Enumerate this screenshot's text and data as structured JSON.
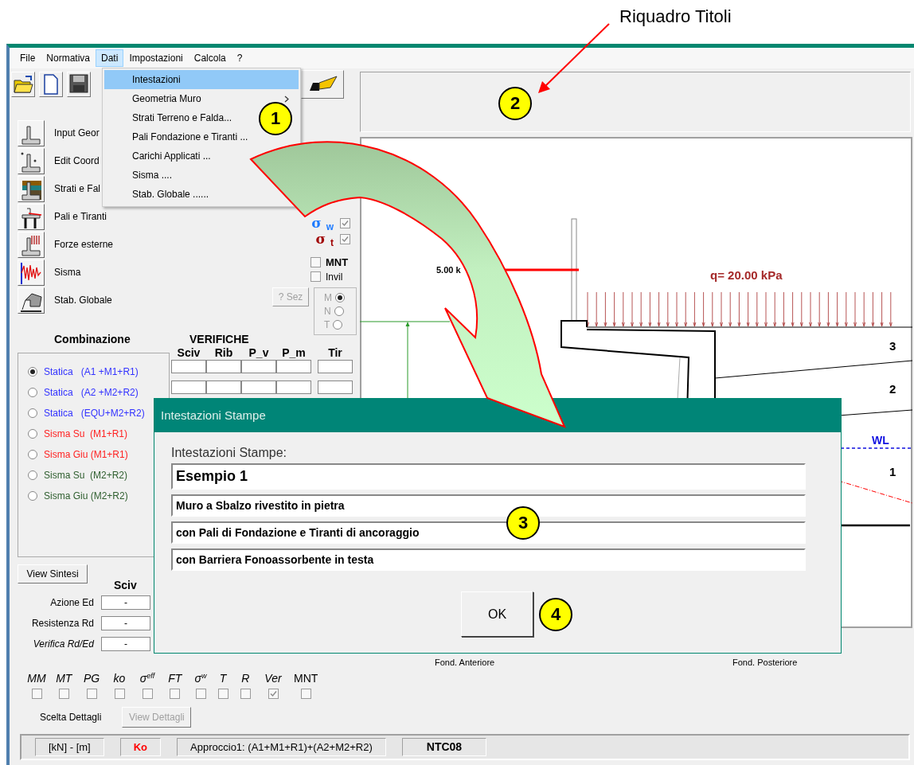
{
  "annotation_label": "Riquadro Titoli",
  "callouts": [
    "1",
    "2",
    "3",
    "4"
  ],
  "menu": [
    {
      "label": "File",
      "selected": false
    },
    {
      "label": "Normativa",
      "selected": false
    },
    {
      "label": "Dati",
      "selected": true
    },
    {
      "label": "Impostazioni",
      "selected": false
    },
    {
      "label": "Calcola",
      "selected": false
    },
    {
      "label": "?",
      "selected": false
    }
  ],
  "dropdown": [
    {
      "label": "Intestazioni",
      "selected": true,
      "submenu": false
    },
    {
      "label": "Geometria Muro",
      "selected": false,
      "submenu": true
    },
    {
      "label": "Strati Terreno e Falda...",
      "selected": false,
      "submenu": false
    },
    {
      "label": "Pali Fondazione e Tiranti ...",
      "selected": false,
      "submenu": false
    },
    {
      "label": "Carichi Applicati ...",
      "selected": false,
      "submenu": false
    },
    {
      "label": "Sisma ....",
      "selected": false,
      "submenu": false
    },
    {
      "label": "Stab. Globale ......",
      "selected": false,
      "submenu": false
    }
  ],
  "tools": [
    "Input Geor",
    "Edit Coord",
    "Strati e Fal",
    "Pali e Tiranti",
    "Forze esterne",
    "Sisma",
    "Stab. Globale"
  ],
  "display_options": [
    {
      "symbol": "σ",
      "sub": "w",
      "checked": true,
      "color": "#1e7bff"
    },
    {
      "symbol": "σ",
      "sub": "t",
      "checked": true,
      "color": "#a00000"
    }
  ],
  "flags": [
    {
      "label": "MNT",
      "checked": false,
      "bold": true
    },
    {
      "label": "Invil",
      "checked": false,
      "bold": false
    }
  ],
  "sez_button": {
    "label": "? Sez",
    "disabled": true
  },
  "section_options": [
    {
      "label": "M",
      "selected": true
    },
    {
      "label": "N",
      "selected": false
    },
    {
      "label": "T",
      "selected": false
    }
  ],
  "combination_title": "Combinazione",
  "combinations": [
    {
      "label": "Statica   (A1 +M1+R1)",
      "selected": true,
      "color": "#3333ff"
    },
    {
      "label": "Statica   (A2 +M2+R2)",
      "selected": false,
      "color": "#3333ff"
    },
    {
      "label": "Statica   (EQU+M2+R2)",
      "selected": false,
      "color": "#3333ff"
    },
    {
      "label": "Sisma Su  (M1+R1)",
      "selected": false,
      "color": "#ff2222"
    },
    {
      "label": "Sisma Giu (M1+R1)",
      "selected": false,
      "color": "#ff2222"
    },
    {
      "label": "Sisma Su  (M2+R2)",
      "selected": false,
      "color": "#2f5f2f"
    },
    {
      "label": "Sisma Giu (M2+R2)",
      "selected": false,
      "color": "#2f5f2f"
    }
  ],
  "checks": {
    "title": "VERIFICHE",
    "columns": [
      "Sciv",
      "Rib",
      "P_v",
      "P_m",
      "Tir"
    ]
  },
  "view_summary": "View Sintesi",
  "summary": {
    "column": "Sciv",
    "rows": [
      {
        "label": "Azione Ed",
        "value": "-",
        "italic": false
      },
      {
        "label": "Resistenza Rd",
        "value": "-",
        "italic": false
      },
      {
        "label": "Verifica Rd/Ed",
        "value": "-",
        "italic": true
      }
    ]
  },
  "detail_toggles": [
    {
      "label": "MM",
      "checked": false,
      "italic": true
    },
    {
      "label": "MT",
      "checked": false,
      "italic": true
    },
    {
      "label": "PG",
      "checked": false,
      "italic": true
    },
    {
      "label": "ko",
      "checked": false,
      "italic": true
    },
    {
      "label": "σ$^{eff}$",
      "checked": false,
      "italic": true
    },
    {
      "label": "FT",
      "checked": false,
      "italic": true
    },
    {
      "label": "σ$^{w}$",
      "checked": false,
      "italic": true
    },
    {
      "label": "T",
      "checked": false,
      "italic": true
    },
    {
      "label": "R",
      "checked": false,
      "italic": true
    },
    {
      "label": "Ver",
      "checked": true,
      "italic": true
    },
    {
      "label": "MNT",
      "checked": false,
      "italic": false
    }
  ],
  "detail_label": "Scelta Dettagli",
  "view_details": {
    "label": "View Dettagli",
    "disabled": true
  },
  "status": [
    {
      "text": "[kN] - [m]",
      "kind": "plain"
    },
    {
      "text": "Ko",
      "kind": "alert"
    },
    {
      "text": "Approccio1: (A1+M1+R1)+(A2+M2+R2)",
      "kind": "plain"
    },
    {
      "text": "NTC08",
      "kind": "bold"
    }
  ],
  "canvas": {
    "force_label": "5.00 k",
    "load_label": "q= 20.00 kPa",
    "layers": [
      "3",
      "2",
      "1"
    ],
    "water_label": "WL",
    "foundation_labels": [
      "Fond. Anteriore",
      "Fond. Posteriore"
    ]
  },
  "dialog": {
    "title": "Intestazioni Stampe",
    "label": "Intestazioni Stampe:",
    "fields": [
      "Esempio 1",
      "Muro a Sbalzo rivestito in pietra",
      "con Pali di Fondazione e Tiranti di ancoraggio",
      "con Barriera Fonoassorbente in testa"
    ],
    "ok": "OK"
  }
}
